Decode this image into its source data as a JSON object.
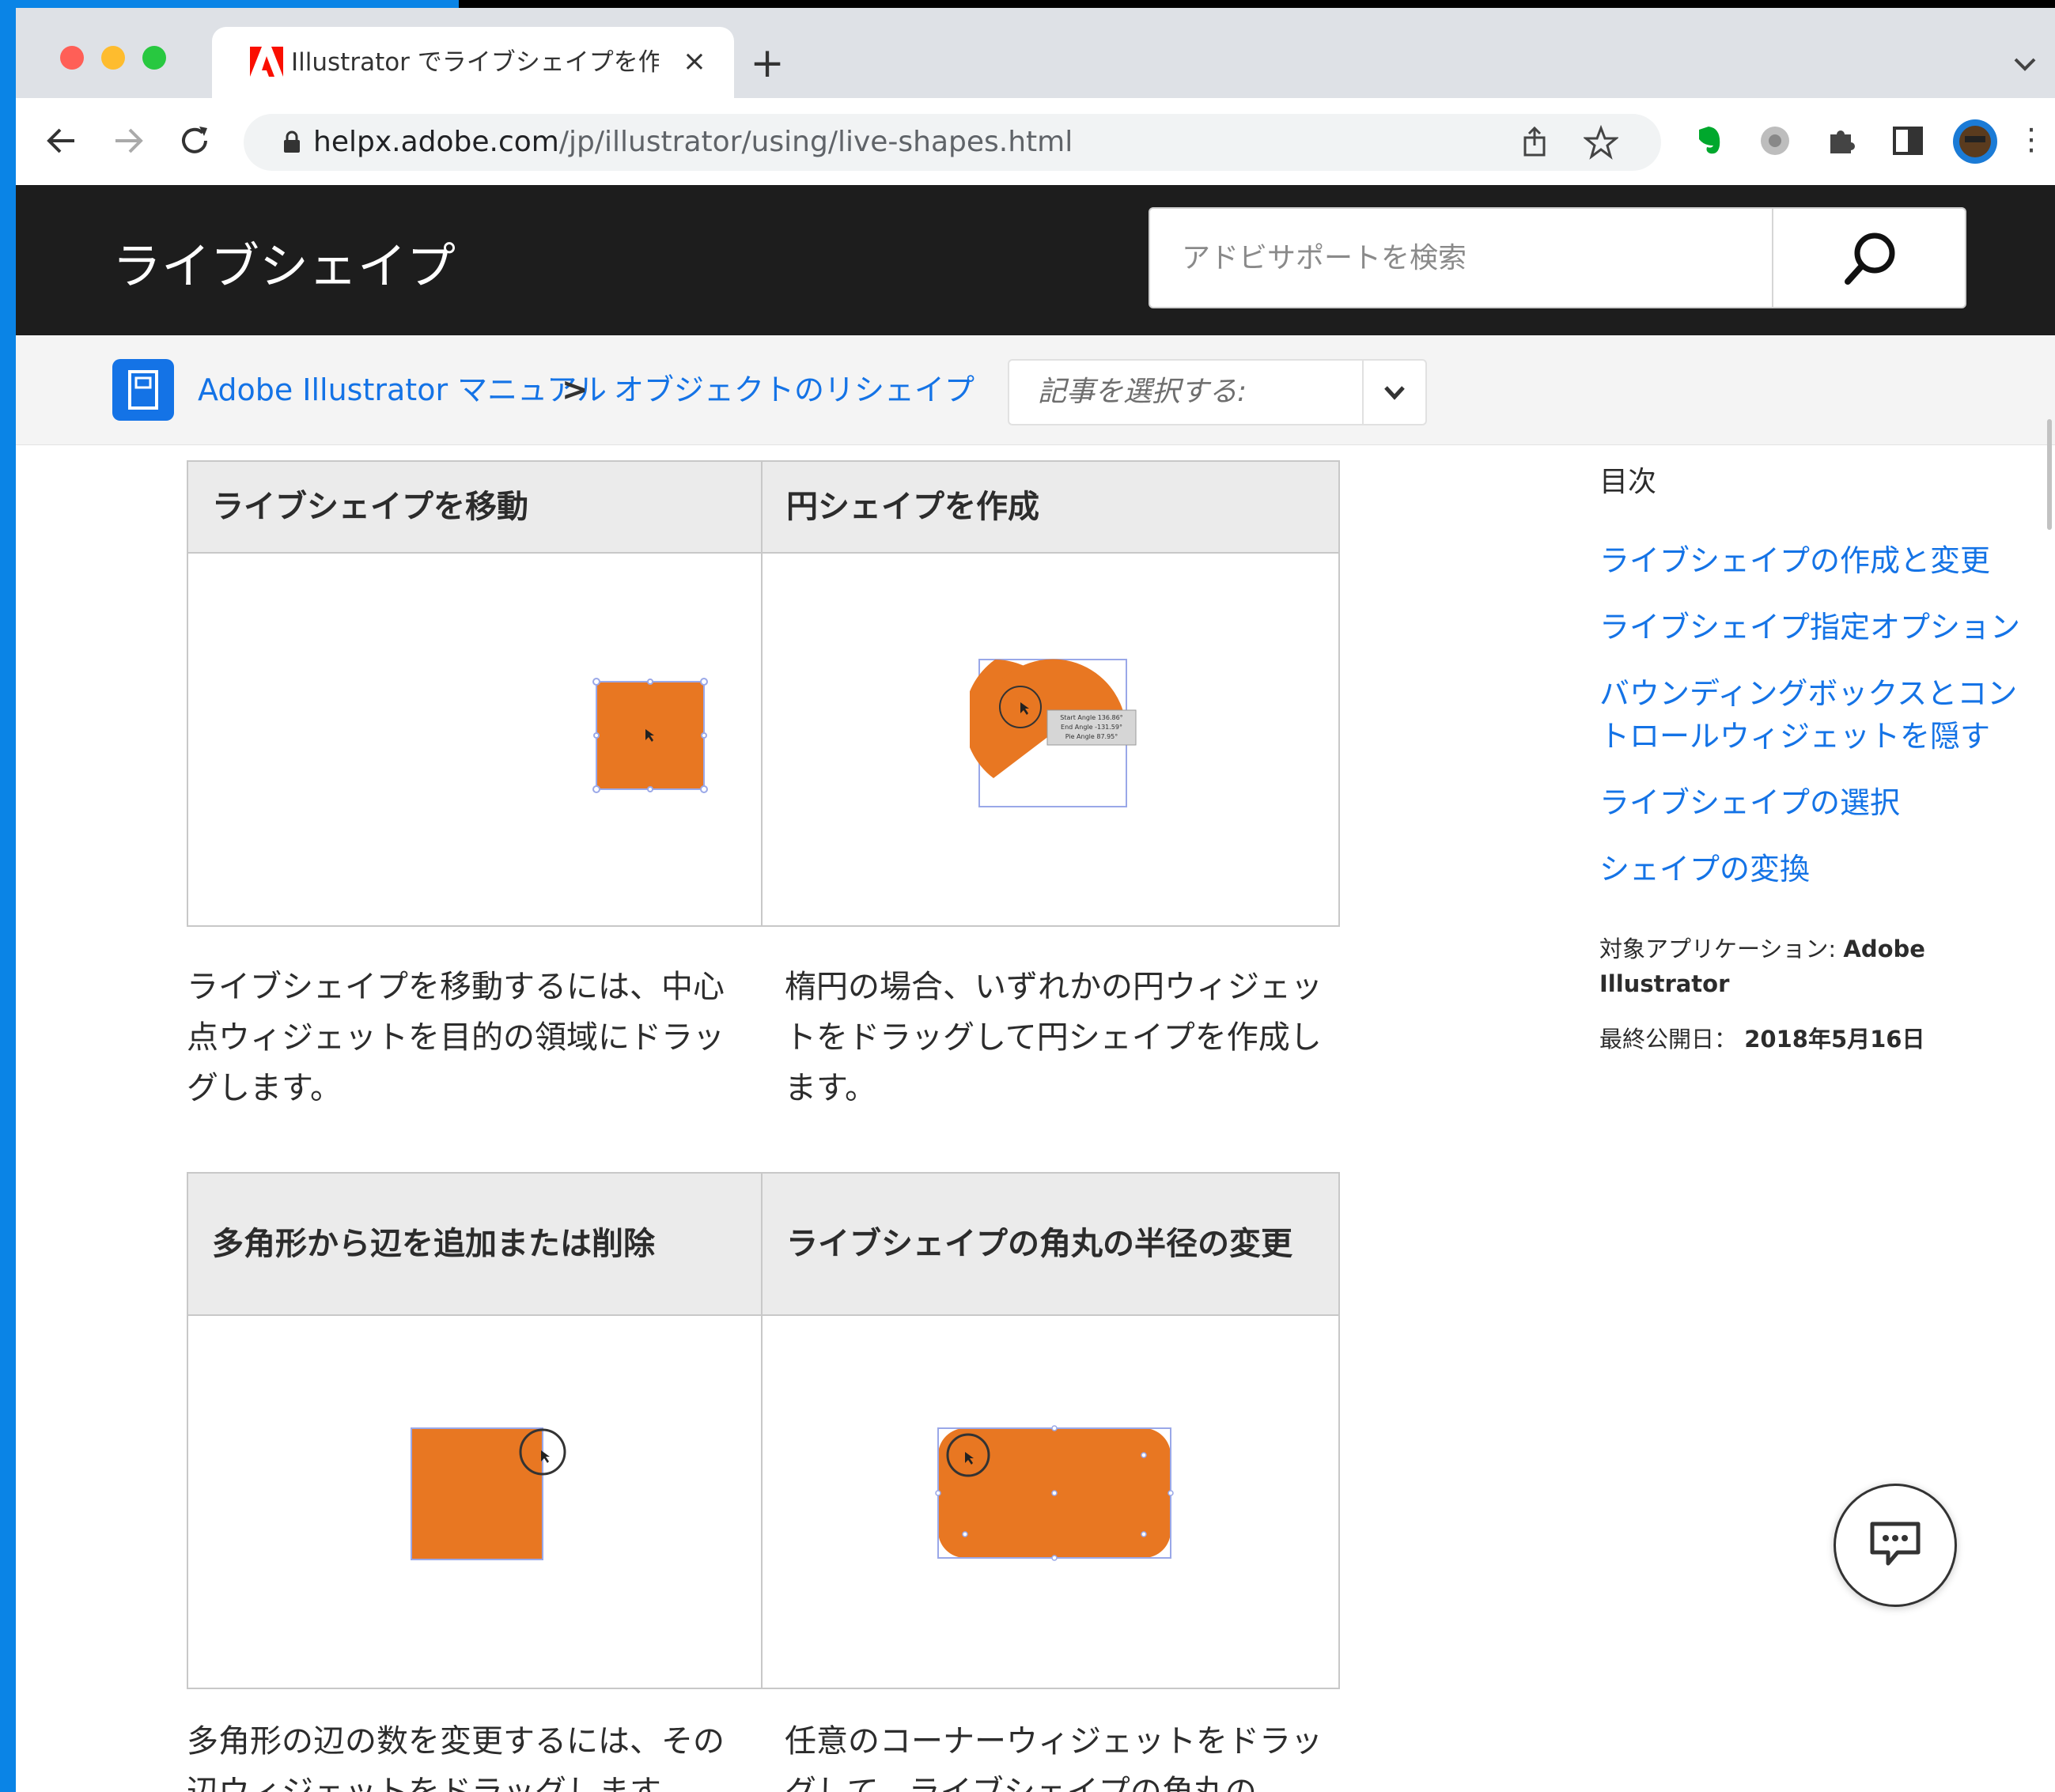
{
  "browser": {
    "tab_title": "Illustrator でライブシェイプを作成",
    "url_host": "helpx.adobe.com",
    "url_path": "/jp/illustrator/using/live-shapes.html"
  },
  "header": {
    "title": "ライブシェイプ",
    "search_placeholder": "アドビサポートを検索"
  },
  "breadcrumb": {
    "items": [
      "Adobe Illustrator マニュアル",
      "オブジェクトのリシェイプ"
    ],
    "separator": ">",
    "select_placeholder": "記事を選択する:"
  },
  "grid1": {
    "headers": [
      "ライブシェイプを移動",
      "円シェイプを作成"
    ],
    "captions": [
      "ライブシェイプを移動するには、中心点ウィジェットを目的の領域にドラッグします。",
      "楕円の場合、いずれかの円ウィジェットをドラッグして円シェイプを作成します。"
    ],
    "pie_tooltip": [
      "Start Angle 136.86°",
      "End Angle -131.59°",
      "Pie Angle 87.95°"
    ]
  },
  "grid2": {
    "headers": [
      "多角形から辺を追加または削除",
      "ライブシェイプの角丸の半径の変更"
    ],
    "captions": [
      "多角形の辺の数を変更するには、その辺ウィジェットをドラッグします。",
      "任意のコーナーウィジェットをドラッグして、ライブシェイプの角丸の"
    ]
  },
  "toc": {
    "title": "目次",
    "links": [
      "ライブシェイプの作成と変更",
      "ライブシェイプ指定オプション",
      "バウンディングボックスとコントロールウィジェットを隠す",
      "ライブシェイプの選択",
      "シェイプの変換"
    ],
    "applies_label": "対象アプリケーション:",
    "applies_value": "Adobe Illustrator",
    "published_label": "最終公開日：",
    "published_value": "2018年5月16日"
  },
  "colors": {
    "accent": "#1473e6",
    "shape_orange": "#e87722",
    "header_bg": "#1d1d1d"
  }
}
